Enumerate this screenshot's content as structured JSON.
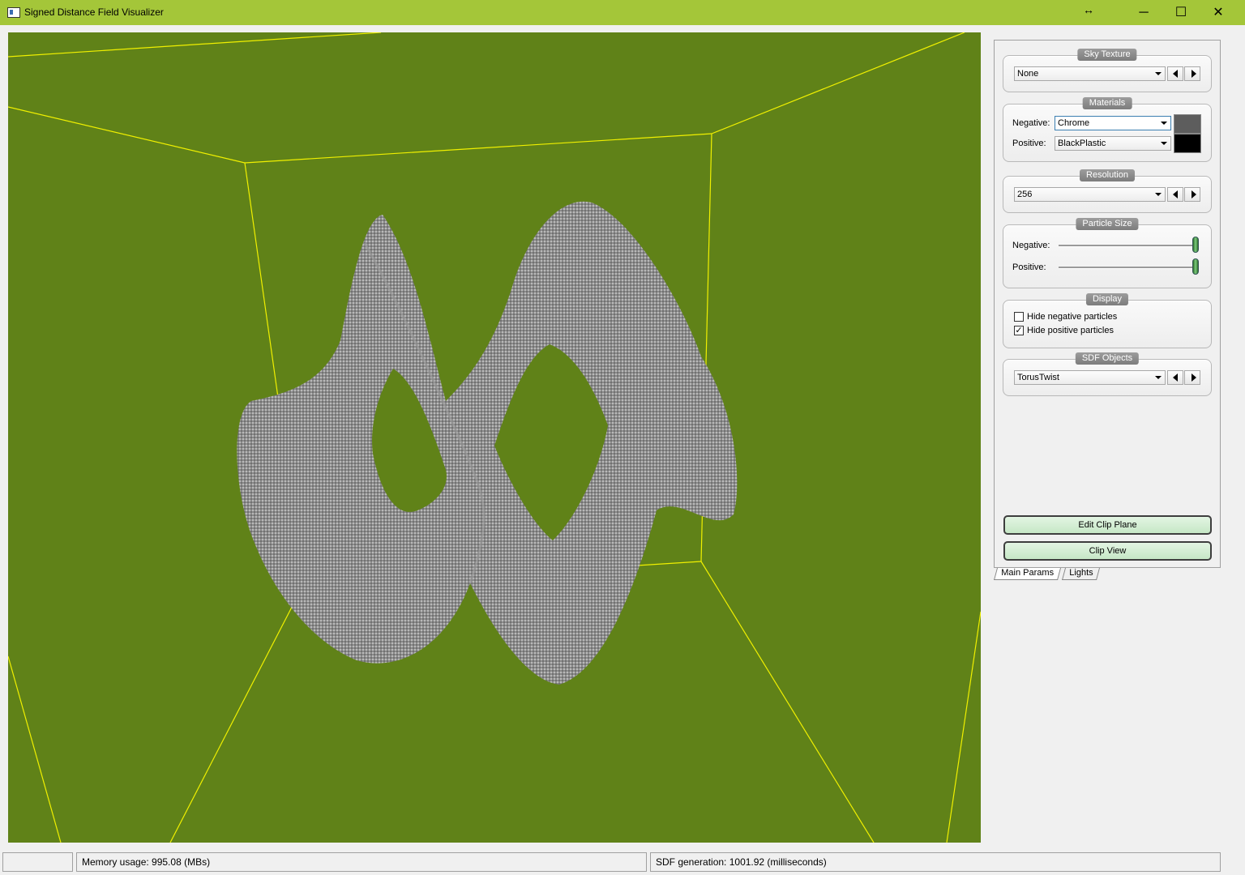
{
  "window": {
    "title": "Signed Distance Field Visualizer",
    "controls": {
      "resize": "↔",
      "minimize": "─",
      "maximize": "☐",
      "close": "✕"
    }
  },
  "viewport": {
    "background_color": "#608218",
    "wire_color": "#f0f000",
    "surface_color": "#8f8f8f"
  },
  "panel": {
    "sky_texture": {
      "title": "Sky Texture",
      "value": "None"
    },
    "materials": {
      "title": "Materials",
      "negative_label": "Negative:",
      "negative_value": "Chrome",
      "negative_color": "#5d5d5d",
      "positive_label": "Positive:",
      "positive_value": "BlackPlastic",
      "positive_color": "#000000"
    },
    "resolution": {
      "title": "Resolution",
      "value": "256"
    },
    "particle_size": {
      "title": "Particle Size",
      "negative_label": "Negative:",
      "positive_label": "Positive:",
      "negative_level": 1.0,
      "positive_level": 1.0
    },
    "display": {
      "title": "Display",
      "hide_negative": {
        "label": "Hide negative particles",
        "checked": false
      },
      "hide_positive": {
        "label": "Hide positive particles",
        "checked": true
      }
    },
    "sdf_objects": {
      "title": "SDF Objects",
      "value": "TorusTwist"
    },
    "edit_clip_plane": "Edit Clip Plane",
    "clip_view": "Clip View",
    "tabs": [
      "Main Params",
      "Lights"
    ]
  },
  "status": {
    "empty": "",
    "memory": "Memory usage: 995.08 (MBs)",
    "sdf_generation": "SDF generation: 1001.92 (milliseconds)"
  }
}
